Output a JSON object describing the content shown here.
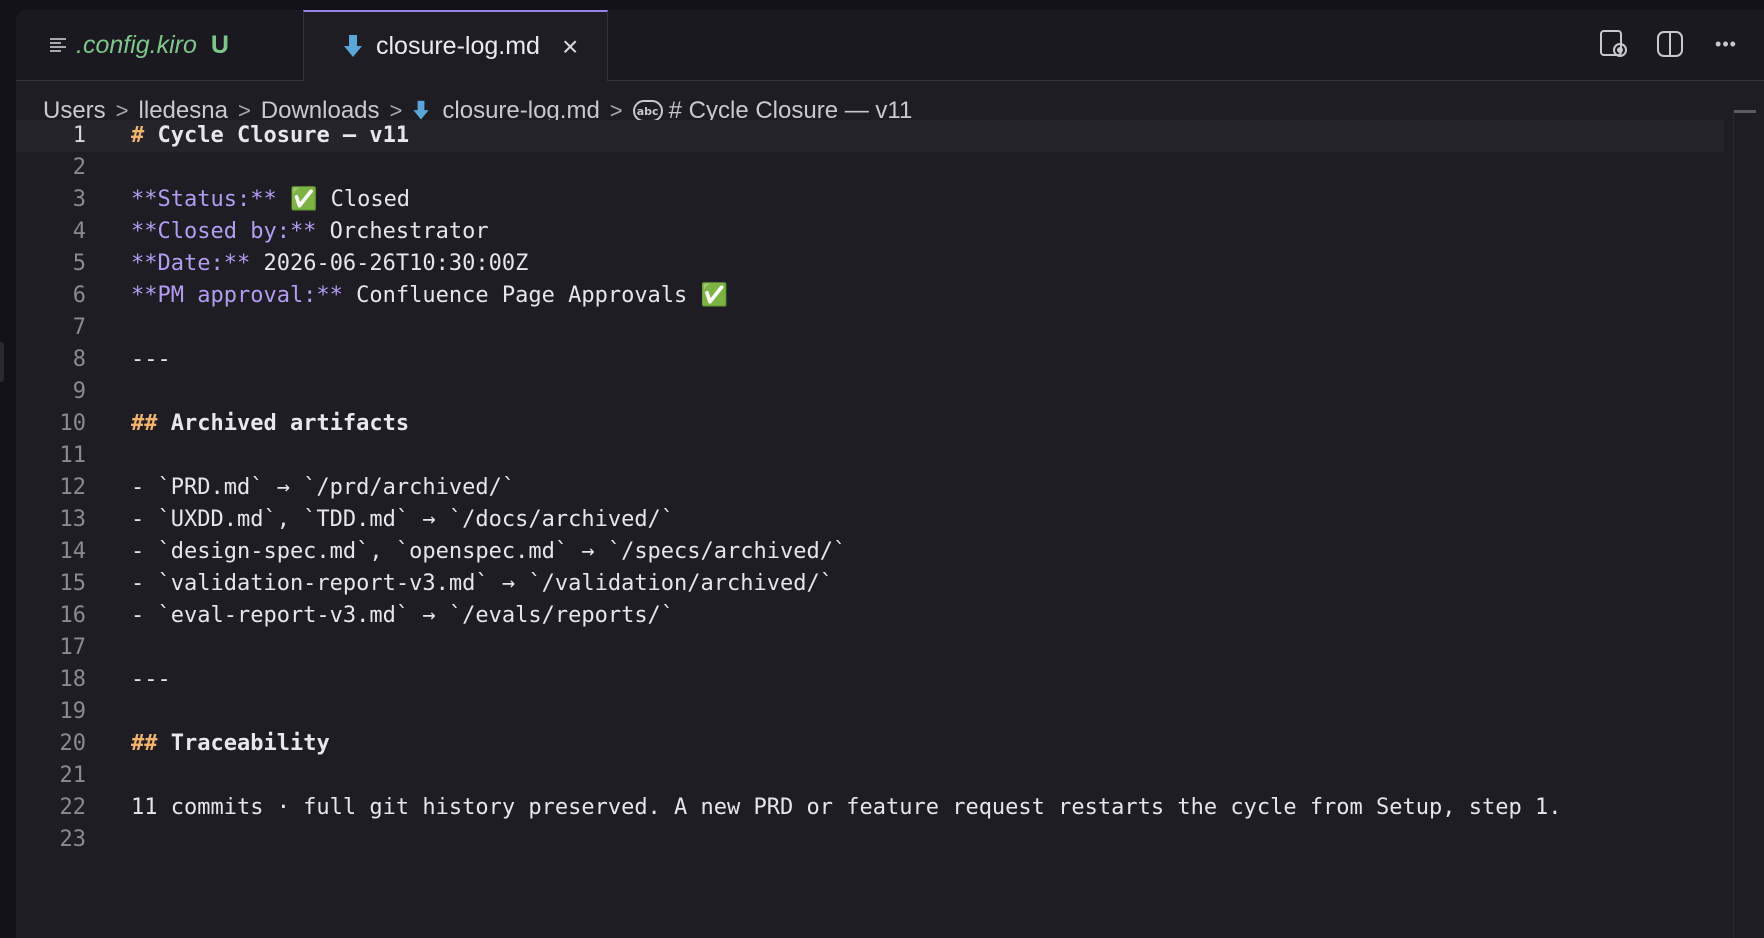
{
  "tabs": [
    {
      "label": ".config.kiro",
      "badge": "U",
      "icon": "list-lines-icon"
    },
    {
      "label": "closure-log.md",
      "close": "×",
      "icon": "markdown-down-arrow-icon"
    }
  ],
  "actions": [
    "open-preview-icon",
    "split-editor-icon",
    "more-actions-icon"
  ],
  "actions_more": "•••",
  "breadcrumb": [
    "Users",
    "lledesna",
    "Downloads",
    "closure-log.md",
    "# Cycle Closure — v11"
  ],
  "breadcrumb_sep": ">",
  "lines": [
    {
      "n": "1",
      "t": "# Cycle Closure — v11"
    },
    {
      "n": "2",
      "t": ""
    },
    {
      "n": "3",
      "t": "**Status:** ✅ Closed"
    },
    {
      "n": "4",
      "t": "**Closed by:** Orchestrator"
    },
    {
      "n": "5",
      "t": "**Date:** 2026-06-26T10:30:00Z"
    },
    {
      "n": "6",
      "t": "**PM approval:** Confluence Page Approvals ✅"
    },
    {
      "n": "7",
      "t": ""
    },
    {
      "n": "8",
      "t": "---"
    },
    {
      "n": "9",
      "t": ""
    },
    {
      "n": "10",
      "t": "## Archived artifacts"
    },
    {
      "n": "11",
      "t": ""
    },
    {
      "n": "12",
      "t": "- `PRD.md` → `/prd/archived/`"
    },
    {
      "n": "13",
      "t": "- `UXDD.md`, `TDD.md` → `/docs/archived/`"
    },
    {
      "n": "14",
      "t": "- `design-spec.md`, `openspec.md` → `/specs/archived/`"
    },
    {
      "n": "15",
      "t": "- `validation-report-v3.md` → `/validation/archived/`"
    },
    {
      "n": "16",
      "t": "- `eval-report-v3.md` → `/evals/reports/`"
    },
    {
      "n": "17",
      "t": ""
    },
    {
      "n": "18",
      "t": "---"
    },
    {
      "n": "19",
      "t": ""
    },
    {
      "n": "20",
      "t": "## Traceability"
    },
    {
      "n": "21",
      "t": ""
    },
    {
      "n": "22",
      "t": "11 commits · full git history preserved. A new PRD or feature request restarts the cycle from Setup, step 1."
    },
    {
      "n": "23",
      "t": ""
    }
  ],
  "colors": {
    "accent": "#9b82e8",
    "heading": "#f0b46e",
    "bold_marker": "#b49cf0",
    "untracked": "#7fc68b"
  }
}
